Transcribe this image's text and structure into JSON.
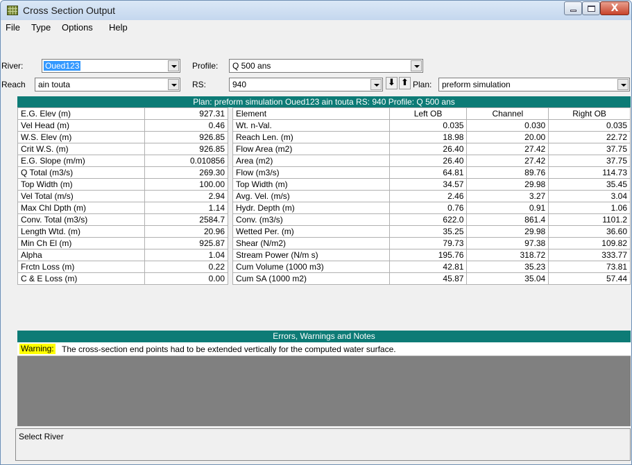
{
  "window": {
    "title": "Cross Section Output",
    "close_glyph": "X"
  },
  "menu": [
    "File",
    "Type",
    "Options",
    "Help"
  ],
  "controls": {
    "river_label": "River:",
    "river_value": "Oued123",
    "profile_label": "Profile:",
    "profile_value": "Q 500 ans",
    "reach_label": "Reach",
    "reach_value": "ain touta",
    "rs_label": "RS:",
    "rs_value": "940",
    "down_glyph": "⬇",
    "up_glyph": "⬆",
    "plan_label": "Plan:",
    "plan_value": "preform simulation"
  },
  "plan_banner": "Plan: preform simulation    Oued123    ain touta  RS: 940    Profile: Q 500 ans",
  "left_table": [
    [
      "E.G. Elev (m)",
      "927.31"
    ],
    [
      "Vel Head (m)",
      "0.46"
    ],
    [
      "W.S. Elev (m)",
      "926.85"
    ],
    [
      "Crit W.S. (m)",
      "926.85"
    ],
    [
      "E.G. Slope (m/m)",
      "0.010856"
    ],
    [
      "Q Total (m3/s)",
      "269.30"
    ],
    [
      "Top Width (m)",
      "100.00"
    ],
    [
      "Vel Total (m/s)",
      "2.94"
    ],
    [
      "Max Chl Dpth (m)",
      "1.14"
    ],
    [
      "Conv. Total (m3/s)",
      "2584.7"
    ],
    [
      "Length Wtd. (m)",
      "20.96"
    ],
    [
      "Min Ch El (m)",
      "925.87"
    ],
    [
      "Alpha",
      "1.04"
    ],
    [
      "Frctn Loss (m)",
      "0.22"
    ],
    [
      "C & E Loss (m)",
      "0.00"
    ]
  ],
  "right_table": {
    "headers": [
      "Element",
      "Left OB",
      "Channel",
      "Right OB"
    ],
    "rows": [
      [
        "Wt. n-Val.",
        "0.035",
        "0.030",
        "0.035"
      ],
      [
        "Reach Len. (m)",
        "18.98",
        "20.00",
        "22.72"
      ],
      [
        "Flow Area (m2)",
        "26.40",
        "27.42",
        "37.75"
      ],
      [
        "Area (m2)",
        "26.40",
        "27.42",
        "37.75"
      ],
      [
        "Flow (m3/s)",
        "64.81",
        "89.76",
        "114.73"
      ],
      [
        "Top Width (m)",
        "34.57",
        "29.98",
        "35.45"
      ],
      [
        "Avg. Vel. (m/s)",
        "2.46",
        "3.27",
        "3.04"
      ],
      [
        "Hydr. Depth (m)",
        "0.76",
        "0.91",
        "1.06"
      ],
      [
        "Conv. (m3/s)",
        "622.0",
        "861.4",
        "1101.2"
      ],
      [
        "Wetted Per. (m)",
        "35.25",
        "29.98",
        "36.60"
      ],
      [
        "Shear (N/m2)",
        "79.73",
        "97.38",
        "109.82"
      ],
      [
        "Stream Power (N/m s)",
        "195.76",
        "318.72",
        "333.77"
      ],
      [
        "Cum Volume (1000 m3)",
        "42.81",
        "35.23",
        "73.81"
      ],
      [
        "Cum SA (1000 m2)",
        "45.87",
        "35.04",
        "57.44"
      ]
    ]
  },
  "notes": {
    "title": "Errors, Warnings and Notes",
    "warning_tag": "Warning:",
    "warning_text": "The cross-section end points had to be extended vertically for the computed water surface."
  },
  "status_text": "Select River",
  "colors": {
    "banner": "#0d7b76",
    "selection": "#3399ff",
    "warning_highlight": "#ffff00",
    "notes_background": "#808080"
  }
}
